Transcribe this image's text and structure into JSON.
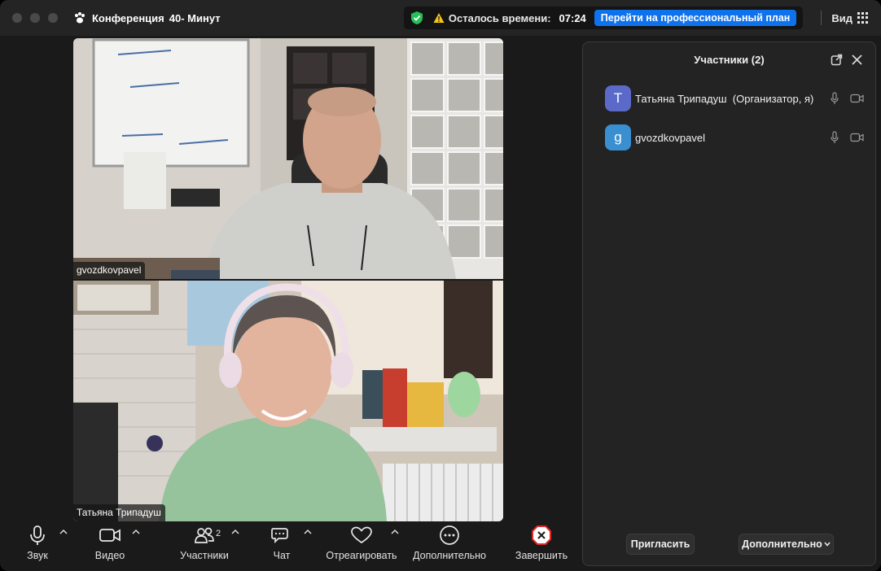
{
  "window": {
    "title": "Конференция",
    "title_suffix": "40- Минут",
    "time_left_label": "Осталось времени:",
    "time_left_value": "07:24",
    "upgrade_button": "Перейти на профессиональный план",
    "view_label": "Вид"
  },
  "videos": [
    {
      "name": "gvozdkovpavel"
    },
    {
      "name": "Татьяна Трипадуш"
    }
  ],
  "toolbar": {
    "audio": "Звук",
    "video": "Видео",
    "participants": "Участники",
    "participants_count": "2",
    "chat": "Чат",
    "react": "Отреагировать",
    "more": "Дополнительно",
    "end": "Завершить"
  },
  "panel": {
    "title": "Участники (2)",
    "participants": [
      {
        "initial": "T",
        "name": "Татьяна Трипадуш  (Организатор, я)",
        "color": "#5b6ac9"
      },
      {
        "initial": "g",
        "name": "gvozdkovpavel",
        "color": "#3a8fd1"
      }
    ],
    "invite_button": "Пригласить",
    "more_button": "Дополнительно"
  },
  "colors": {
    "accent": "#0e72ed",
    "end_red": "#e02828",
    "secure_green": "#27c058"
  },
  "icons": {
    "secure": "shield-check-icon",
    "warning": "warning-triangle-icon",
    "view": "grid-icon",
    "mic": "microphone-icon",
    "camera": "video-camera-icon",
    "participants": "people-icon",
    "chat": "chat-bubbles-icon",
    "react": "heart-icon",
    "more": "ellipsis-circle-icon",
    "end": "close-hexagon-icon"
  }
}
